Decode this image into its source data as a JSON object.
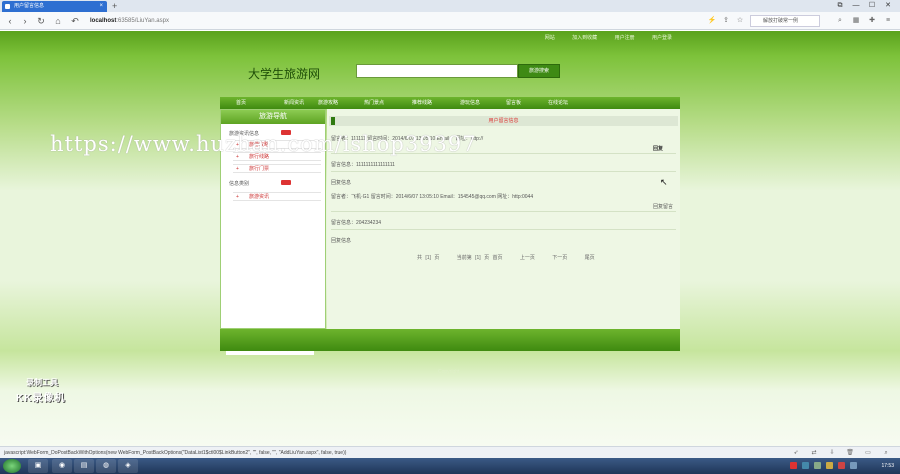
{
  "browser": {
    "tab_title": "用户留言信息",
    "tab_close": "×",
    "new_tab": "+",
    "url_host": "localhost",
    "url_path": ":63585/LiuYan.aspx",
    "search_placeholder": "解放打破常一例",
    "win_controls": [
      "⧉",
      "—",
      "☐",
      "✕"
    ]
  },
  "site": {
    "top_links": [
      "网站",
      "加入到收藏",
      "用户注册",
      "用户登录"
    ],
    "title": "大学生旅游网",
    "search_button": "旅游搜索",
    "nav": [
      "首页",
      "新闻资讯",
      "旅游攻略",
      "热门景点",
      "推荐线路",
      "游玩信息",
      "留言板",
      "在线论坛"
    ]
  },
  "sidebar": {
    "title": "旅游导航",
    "categories": [
      "旅游资讯信息",
      "信息类别"
    ],
    "items": [
      "旅游攻略",
      "旅行线路",
      "旅行门票",
      "旅游资讯"
    ]
  },
  "main": {
    "header": "用户留言信息",
    "messages": [
      {
        "line1": "留言者：111111  留言时间：2014/6/07  13:05:10  Email：  网址：http://",
        "reply": "回复"
      },
      {
        "content": "留言信息：1111111111111111"
      },
      {
        "section": "回复信息"
      },
      {
        "line1": "留言者：飞机·G1  留言时间：2014/6/07  13:05:10  Email：154545@qq.com  网址：http:0044",
        "reply": "回复留言"
      },
      {
        "content": "留言信息：204234234"
      },
      {
        "section": "回复信息"
      }
    ],
    "pager": [
      "共 [1] 页",
      "当前第 [1] 页  首页",
      "上一页",
      "下一页",
      "尾页"
    ]
  },
  "footer": {
    "copyright": "Copyright"
  },
  "watermarks": {
    "recorder_line1": "录制工具",
    "recorder_line2": "KK录像机",
    "url_overlay": "https://www.huzhan.com/ishop39397"
  },
  "status": {
    "text": "javascript:WebForm_DoPostBackWithOptions(new WebForm_PostBackOptions(\"DataList1$ctl00$LinkButton2\", \"\", false, \"\", \"AddLiuYan.aspx\", false, true))"
  },
  "taskbar": {
    "clock": "17:53"
  },
  "colors": {
    "accent": "#3f8a10",
    "nav_green": "#6db42d",
    "alert_red": "#d33"
  }
}
